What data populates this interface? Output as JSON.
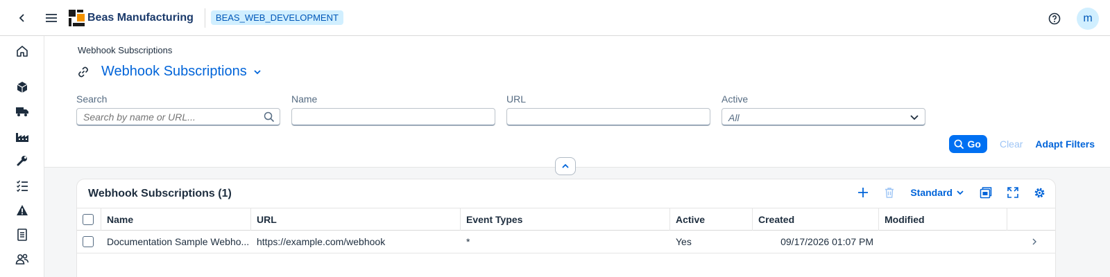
{
  "topbar": {
    "brand": "Beas Manufacturing",
    "system": "BEAS_WEB_DEVELOPMENT",
    "user_initial": "m"
  },
  "sidebar": {
    "items": [
      "home-icon",
      "products-icon",
      "shipping-icon",
      "factory-icon",
      "tools-icon",
      "checklist-icon",
      "warning-icon",
      "document-icon",
      "users-icon"
    ]
  },
  "header": {
    "breadcrumb": "Webhook Subscriptions",
    "title": "Webhook Subscriptions"
  },
  "filters": {
    "search": {
      "label": "Search",
      "placeholder": "Search by name or URL..."
    },
    "name": {
      "label": "Name",
      "placeholder": ""
    },
    "url": {
      "label": "URL",
      "placeholder": ""
    },
    "active": {
      "label": "Active",
      "value": "All"
    },
    "go_label": "Go",
    "clear_label": "Clear",
    "adapt_label": "Adapt Filters"
  },
  "table": {
    "title": "Webhook Subscriptions (1)",
    "variant": "Standard",
    "columns": [
      "Name",
      "URL",
      "Event Types",
      "Active",
      "Created",
      "Modified"
    ],
    "rows": [
      {
        "name": "Documentation Sample Webho...",
        "url": "https://example.com/webhook",
        "event_types": "*",
        "active": "Yes",
        "created": "09/17/2026 01:07 PM",
        "modified": ""
      }
    ]
  },
  "colors": {
    "accent": "#0064d9",
    "button": "#0070f2",
    "badge_bg": "#d1efff"
  }
}
